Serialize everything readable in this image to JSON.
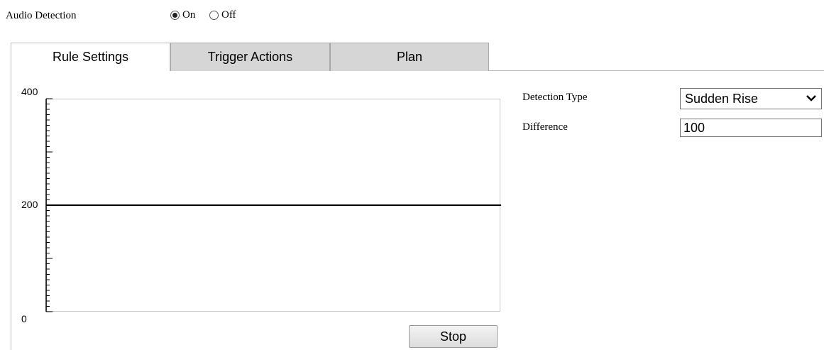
{
  "audio_detection": {
    "label": "Audio Detection",
    "options": [
      {
        "label": "On",
        "checked": true
      },
      {
        "label": "Off",
        "checked": false
      }
    ]
  },
  "tabs": [
    {
      "label": "Rule Settings",
      "active": true
    },
    {
      "label": "Trigger Actions",
      "active": false
    },
    {
      "label": "Plan",
      "active": false
    }
  ],
  "graph": {
    "y_max_label": "400",
    "y_mid_label": "200",
    "y_min_label": "0",
    "threshold_value": 200
  },
  "stop_button": {
    "label": "Stop"
  },
  "detection_type": {
    "label": "Detection Type",
    "value": "Sudden Rise"
  },
  "difference": {
    "label": "Difference",
    "value": "100"
  }
}
